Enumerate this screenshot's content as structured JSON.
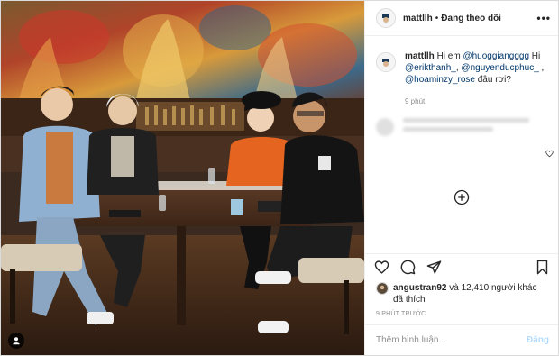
{
  "post": {
    "username": "mattllh",
    "separator": "•",
    "follow_label": "Đang theo dõi",
    "more_label": "•••"
  },
  "caption": {
    "username": "mattllh",
    "text_1": "Hi em ",
    "mention_1": "@huoggiangggg",
    "text_2": " Hi ",
    "mention_2": "@erikthanh_",
    "text_3": ", ",
    "mention_3": "@nguyenducphuc_",
    "text_4": " , ",
    "mention_4": "@hoaminzy_rose",
    "text_5": " đâu rơi?",
    "time": "9 phút"
  },
  "likes": {
    "liker": "angustran92",
    "text": " và 12,410 người khác",
    "text_2": "đã thích",
    "ago": "9 PHÚT TRƯỚC"
  },
  "comment_box": {
    "placeholder": "Thêm bình luận...",
    "post_label": "Đăng"
  },
  "icons": {
    "heart": "heart-icon",
    "comment": "comment-icon",
    "share": "share-icon",
    "save": "bookmark-icon",
    "add": "plus-circle-icon",
    "user_tag": "user-tag-icon"
  },
  "colors": {
    "mention": "#00376b",
    "post_disabled": "#b3dbff",
    "meta": "#8e8e8e"
  }
}
